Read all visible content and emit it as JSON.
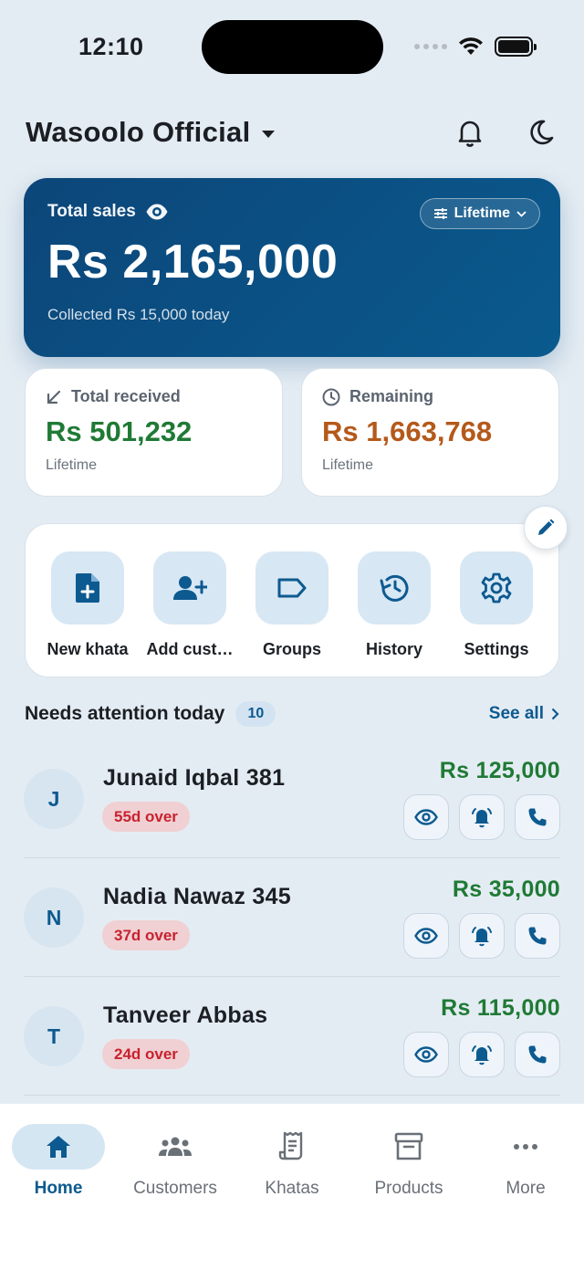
{
  "status_bar": {
    "time": "12:10"
  },
  "header": {
    "title": "Wasoolo Official",
    "icons": [
      "bell-icon",
      "moon-icon"
    ]
  },
  "sales": {
    "label": "Total sales",
    "period": "Lifetime",
    "amount": "Rs 2,165,000",
    "sub": "Collected Rs 15,000 today"
  },
  "stats": {
    "received": {
      "label": "Total received",
      "value": "Rs 501,232",
      "sub": "Lifetime",
      "color": "#1f7a35"
    },
    "remaining": {
      "label": "Remaining",
      "value": "Rs 1,663,768",
      "sub": "Lifetime",
      "color": "#b4591a"
    }
  },
  "actions": [
    {
      "label": "New khata",
      "icon": "new-file-icon"
    },
    {
      "label": "Add cust…",
      "icon": "add-user-icon"
    },
    {
      "label": "Groups",
      "icon": "tag-icon"
    },
    {
      "label": "History",
      "icon": "history-icon"
    },
    {
      "label": "Settings",
      "icon": "gear-icon"
    }
  ],
  "attention": {
    "title": "Needs attention today",
    "count": "10",
    "see_all": "See all",
    "rows": [
      {
        "initial": "J",
        "name": "Junaid Iqbal 381",
        "badge": "55d over",
        "amount": "Rs 125,000"
      },
      {
        "initial": "N",
        "name": "Nadia Nawaz 345",
        "badge": "37d over",
        "amount": "Rs 35,000"
      },
      {
        "initial": "T",
        "name": "Tanveer Abbas",
        "badge": "24d over",
        "amount": "Rs 115,000"
      }
    ]
  },
  "nav": [
    {
      "label": "Home",
      "icon": "home-icon",
      "active": true
    },
    {
      "label": "Customers",
      "icon": "customers-icon"
    },
    {
      "label": "Khatas",
      "icon": "receipt-icon"
    },
    {
      "label": "Products",
      "icon": "archive-icon"
    },
    {
      "label": "More",
      "icon": "more-icon"
    }
  ],
  "colors": {
    "primary": "#0d5a90",
    "card": "#0a5a8e",
    "green": "#1f7a35",
    "orange": "#b4591a",
    "danger": "#c8222f"
  }
}
